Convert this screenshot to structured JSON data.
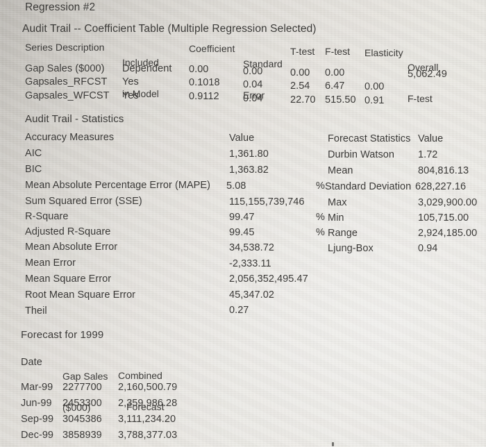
{
  "report": {
    "title": "Regression #2",
    "coefficient_section_title": "Audit Trail -- Coefficient Table (Multiple Regression Selected)",
    "statistics_section_title": "Audit Trail - Statistics",
    "forecast_section_title": "Forecast for 1999"
  },
  "coefficient_table": {
    "headers": {
      "series_description": "Series Description",
      "included_in_model_line1": "Included",
      "included_in_model_line2": "in Model",
      "coefficient": "Coefficient",
      "standard_error_line1": "Standard",
      "standard_error_line2": "Error",
      "t_test": "T-test",
      "f_test": "F-test",
      "elasticity": "Elasticity",
      "overall_f_test_line1": "Overall",
      "overall_f_test_line2": "F-test"
    },
    "rows": [
      {
        "series": "Gap Sales ($000)",
        "included": "Dependent",
        "coefficient": "0.00",
        "standard_error": "0.00",
        "t_test": "0.00",
        "f_test": "0.00",
        "elasticity": "",
        "overall_f_test": "5,062.49"
      },
      {
        "series": "Gapsales_RFCST",
        "included": "Yes",
        "coefficient": "0.1018",
        "standard_error": "0.04",
        "t_test": "2.54",
        "f_test": "6.47",
        "elasticity": "0.00",
        "overall_f_test": ""
      },
      {
        "series": "Gapsales_WFCST",
        "included": "Yes",
        "coefficient": "0.9112",
        "standard_error": "0.04",
        "t_test": "22.70",
        "f_test": "515.50",
        "elasticity": "0.91",
        "overall_f_test": ""
      }
    ]
  },
  "statistics": {
    "accuracy_header": "Accuracy Measures",
    "accuracy_value_header": "Value",
    "forecast_header": "Forecast Statistics",
    "forecast_value_header": "Value",
    "accuracy_rows": [
      {
        "label": "AIC",
        "value": "1,361.80",
        "pct": ""
      },
      {
        "label": "BIC",
        "value": "1,363.82",
        "pct": ""
      },
      {
        "label": "Mean Absolute Percentage Error (MAPE)",
        "value": "5.08",
        "pct": "%"
      },
      {
        "label": "Sum Squared Error (SSE)",
        "value": "115,155,739,746",
        "pct": ""
      },
      {
        "label": "R-Square",
        "value": "99.47",
        "pct": "%"
      },
      {
        "label": "Adjusted R-Square",
        "value": "99.45",
        "pct": "%"
      },
      {
        "label": "Mean Absolute Error",
        "value": "34,538.72",
        "pct": ""
      },
      {
        "label": "Mean Error",
        "value": "-2,333.11",
        "pct": ""
      },
      {
        "label": "Mean Square Error",
        "value": "2,056,352,495.47",
        "pct": ""
      },
      {
        "label": "Root Mean Square Error",
        "value": "45,347.02",
        "pct": ""
      },
      {
        "label": "Theil",
        "value": "0.27",
        "pct": ""
      }
    ],
    "forecast_rows": [
      {
        "label": "Durbin Watson",
        "value": "1.72"
      },
      {
        "label": "Mean",
        "value": "804,816.13"
      },
      {
        "label": "Standard Deviation",
        "value": "628,227.16"
      },
      {
        "label": "Max",
        "value": "3,029,900.00"
      },
      {
        "label": "Min",
        "value": "105,715.00"
      },
      {
        "label": "Range",
        "value": "2,924,185.00"
      },
      {
        "label": "Ljung-Box",
        "value": "0.94"
      }
    ]
  },
  "forecast_table": {
    "headers": {
      "date": "Date",
      "gap_sales_line1": "Gap Sales",
      "gap_sales_line2": "($000)",
      "combined_line1": "Combined",
      "combined_line2": "Forecast"
    },
    "rows": [
      {
        "date": "Mar-99",
        "gap_sales": "2277700",
        "combined_forecast": "2,160,500.79"
      },
      {
        "date": "Jun-99",
        "gap_sales": "2453300",
        "combined_forecast": "2,359,986.28"
      },
      {
        "date": "Sep-99",
        "gap_sales": "3045386",
        "combined_forecast": "3,111,234.20"
      },
      {
        "date": "Dec-99",
        "gap_sales": "3858939",
        "combined_forecast": "3,788,377.03"
      }
    ]
  }
}
